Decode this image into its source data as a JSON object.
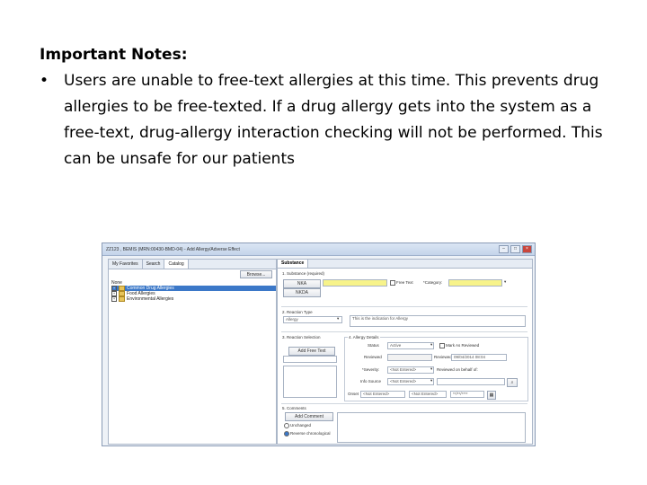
{
  "notes": {
    "heading": "Important Notes:",
    "bullet_symbol": "•",
    "bullet_text": "Users are unable to free-text allergies at this time. This prevents drug allergies to be free-texted. If a drug allergy gets into the system as a free-text, drug-allergy interaction checking will not be performed. This can be unsafe for our patients"
  },
  "screenshot": {
    "window_title": "ZZ123 , BEMIS (MRN:00430-BMD-04) - Add Allergy/Adverse Effect",
    "left_tabs": [
      "My Favorites",
      "Search",
      "Catalog"
    ],
    "browse_label": "Browse...",
    "tree": {
      "root": "None",
      "items": [
        "Common Drug Allergies",
        "Food Allergies",
        "Environmental Allergies"
      ]
    },
    "right_tab": "Substance",
    "section_1": "1. Substance (required)",
    "nka_label": "NKA",
    "nkda_label": "NKDA",
    "free_text_label": "Free Text",
    "category_label": "*Category:",
    "section_2": "2. Reaction Type",
    "reaction_type_value": "Allergy",
    "reaction_desc": "This is the indication for Allergy",
    "section_3": "3. Reaction Selection",
    "add_free_text_label": "Add Free Text",
    "section_4": "4. Allergy Details",
    "status_label": "Status",
    "status_value": "Active",
    "mark_reviewed_label": "Mark As Reviewed",
    "reviewed_label": "Reviewed",
    "reviewed_date": "09/04/2014 08:04",
    "severity_label": "*Severity:",
    "severity_value": "<Not Entered>",
    "reviewed_by_label": "Reviewed on behalf of:",
    "info_source_label": "Info Source",
    "info_source_value": "<Not Entered>",
    "onset_label": "Onset",
    "onset_value_1": "<Not Entered>",
    "onset_value_2": "<Not Entered>",
    "onset_date": "**/**/****",
    "section_5": "5. Comments",
    "add_comment_label": "Add Comment",
    "radio_1": "Unchanged",
    "radio_2": "Reverse chronological"
  }
}
